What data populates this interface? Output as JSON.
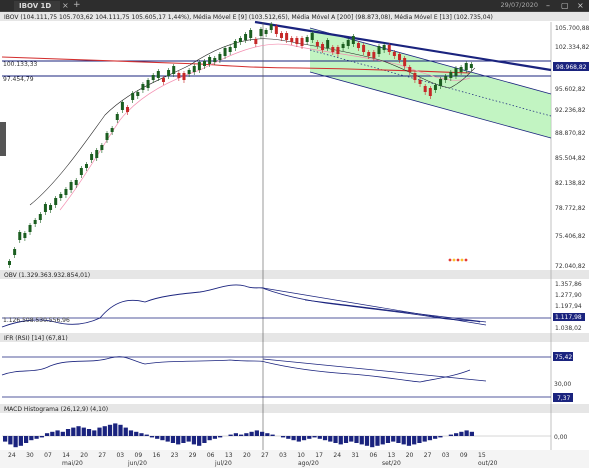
{
  "window": {
    "tab_label": "IBOV 1D",
    "tab_close": "×",
    "tab_add": "+",
    "date": "29/07/2020",
    "minimize": "–",
    "restore": "▢",
    "close": "×"
  },
  "price_panel": {
    "header": "IBOV (104.111,75  105.703,62  104.111,75  105.605,17  1,44%), Média Móvel E [9] (103.512,65), Média Móvel A [200] (98.873,08), Média Móvel E [13] (102.735,04)",
    "y_labels": [
      "105.700,88",
      "102.334,82",
      "98.968,82",
      "95.602,82",
      "92.236,82",
      "88.870,82",
      "85.504,82",
      "82.138,82",
      "78.772,82",
      "75.406,82",
      "72.040,82"
    ],
    "line_label_1": "100.133,33",
    "line_label_2": "97.454,79",
    "badge_current": "98.968,82",
    "badge_current_color": "#1a237e"
  },
  "obv_panel": {
    "header": "OBV (1.329.363.932.854,01)",
    "y_labels": [
      "1.357,86",
      "1.277,90",
      "1.197,94",
      "1.117,98",
      "1.038,02"
    ],
    "line_label": "1.126.508.530.556,96"
  },
  "ifr_panel": {
    "header": "IFR (RSI) [14] (67,81)",
    "y_labels": [
      "30,00"
    ],
    "badge_top": "75,42",
    "badge_bottom": "7,37"
  },
  "macd_panel": {
    "header": "MACD Histograma (26,12,9) (4,10)",
    "y_labels": [
      "0,00"
    ]
  },
  "x_axis": {
    "days": [
      "24",
      "30",
      "07",
      "14",
      "20",
      "27",
      "03",
      "09",
      "16",
      "23",
      "29",
      "06",
      "13",
      "20",
      "27",
      "03",
      "10",
      "17",
      "24",
      "31",
      "06",
      "13",
      "20",
      "27",
      "03",
      "09",
      "15"
    ],
    "months": [
      "mai/20",
      "jun/20",
      "jul/20",
      "ago/20",
      "set/20",
      "out/20"
    ]
  },
  "colors": {
    "up_candle": "#1b5e20",
    "down_candle": "#c62828",
    "ma200": "#d32f2f",
    "channel_fill": "#a8f0a8",
    "trendline": "#1a237e"
  }
}
